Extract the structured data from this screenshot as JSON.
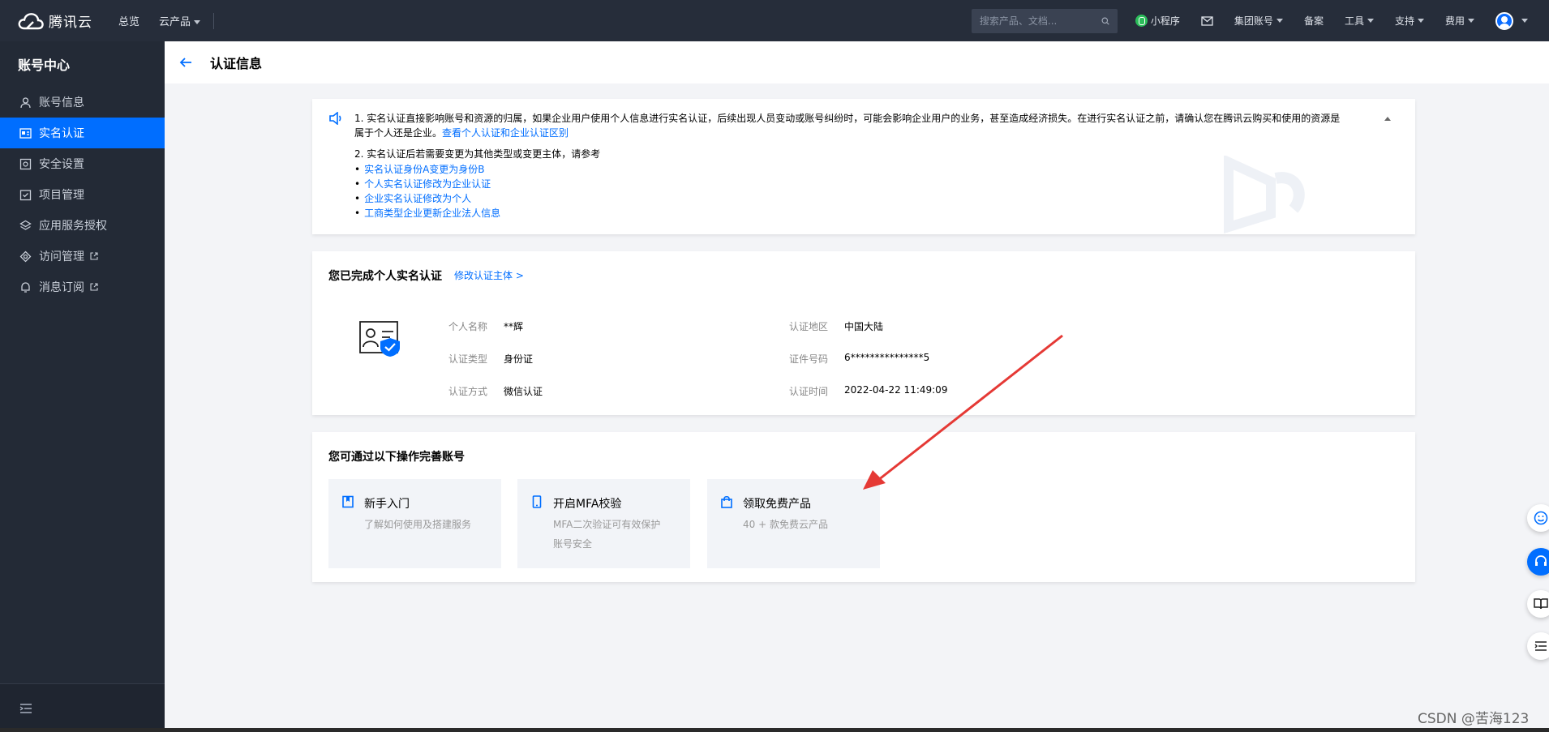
{
  "topbar": {
    "logo_text": "腾讯云",
    "nav": [
      "总览",
      "云产品"
    ],
    "search_placeholder": "搜索产品、文档...",
    "right_items": [
      "小程序",
      "集团账号",
      "备案",
      "工具",
      "支持",
      "费用"
    ]
  },
  "sidebar": {
    "title": "账号中心",
    "items": [
      {
        "label": "账号信息",
        "icon": "user-icon"
      },
      {
        "label": "实名认证",
        "icon": "id-card-icon",
        "active": true
      },
      {
        "label": "安全设置",
        "icon": "shield-icon"
      },
      {
        "label": "项目管理",
        "icon": "project-icon"
      },
      {
        "label": "应用服务授权",
        "icon": "layers-icon"
      },
      {
        "label": "访问管理",
        "icon": "access-icon",
        "external": true
      },
      {
        "label": "消息订阅",
        "icon": "bell-icon",
        "external": true
      }
    ]
  },
  "page": {
    "title": "认证信息"
  },
  "notice": {
    "line1": "1. 实名认证直接影响账号和资源的归属，如果企业用户使用个人信息进行实名认证，后续出现人员变动或账号纠纷时，可能会影响企业用户的业务，甚至造成经济损失。在进行实名认证之前，请确认您在腾讯云购买和使用的资源是",
    "line1b": "属于个人还是企业。",
    "line1_link": "查看个人认证和企业认证区别",
    "line2": "2. 实名认证后若需要变更为其他类型或变更主体，请参考",
    "links": [
      "实名认证身份A变更为身份B",
      "个人实名认证修改为企业认证",
      "企业实名认证修改为个人",
      "工商类型企业更新企业法人信息"
    ]
  },
  "auth": {
    "title": "您已完成个人实名认证",
    "modify_link": "修改认证主体 >",
    "fields": [
      {
        "label": "个人名称",
        "value": "**辉"
      },
      {
        "label": "认证类型",
        "value": "身份证"
      },
      {
        "label": "认证方式",
        "value": "微信认证"
      },
      {
        "label": "认证地区",
        "value": "中国大陆"
      },
      {
        "label": "证件号码",
        "value": "6***************5"
      },
      {
        "label": "认证时间",
        "value": "2022-04-22 11:49:09"
      }
    ]
  },
  "ops": {
    "title": "您可通过以下操作完善账号",
    "items": [
      {
        "title": "新手入门",
        "desc": "了解如何使用及搭建服务",
        "icon": "book-icon"
      },
      {
        "title": "开启MFA校验",
        "desc": "MFA二次验证可有效保护账号安全",
        "icon": "phone-icon"
      },
      {
        "title": "领取免费产品",
        "desc": "40 + 款免费云产品",
        "icon": "bag-icon"
      }
    ]
  },
  "watermark": "CSDN @苦海123",
  "colors": {
    "accent": "#006eff",
    "topbar": "#262d3a",
    "sidebar": "#232a36",
    "arrow": "#e53935"
  }
}
